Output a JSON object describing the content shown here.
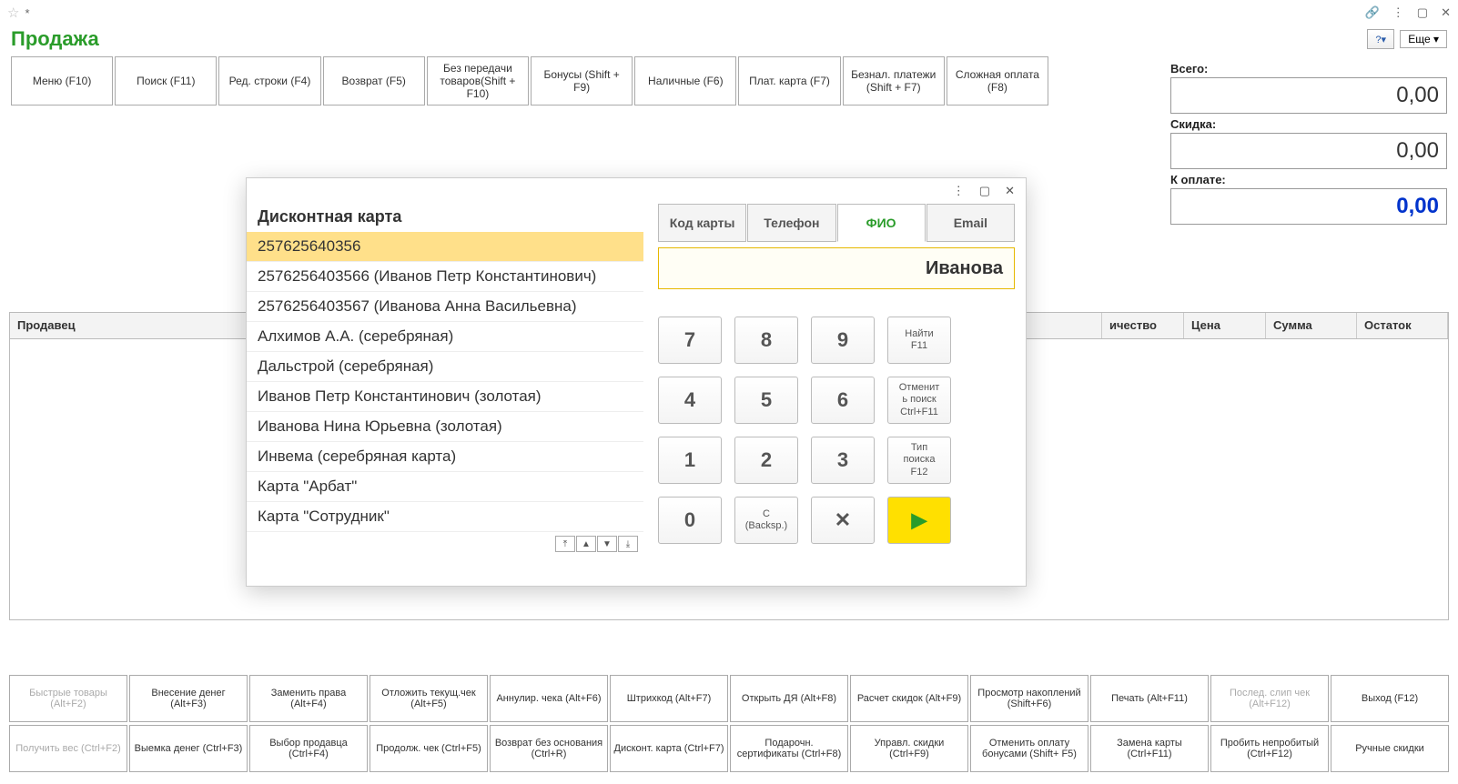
{
  "window": {
    "star": "☆",
    "asterisk": "*"
  },
  "title": "Продажа",
  "more_label": "Еще",
  "toolbar": [
    "Меню (F10)",
    "Поиск (F11)",
    "Ред. строки (F4)",
    "Возврат (F5)",
    "Без передачи товаров(Shift + F10)",
    "Бонусы (Shift + F9)",
    "Наличные (F6)",
    "Плат. карта (F7)",
    "Безнал. платежи (Shift + F7)",
    "Сложная оплата (F8)"
  ],
  "totals": {
    "vsego_label": "Всего:",
    "vsego_value": "0,00",
    "skidka_label": "Скидка:",
    "skidka_value": "0,00",
    "koplate_label": "К оплате:",
    "koplate_value": "0,00"
  },
  "grid_cols": [
    "Продавец",
    "ичество",
    "Цена",
    "Сумма",
    "Остаток"
  ],
  "bottom": [
    [
      {
        "t": "Быстрые товары (Alt+F2)",
        "d": true
      },
      {
        "t": "Внесение денег (Alt+F3)"
      },
      {
        "t": "Заменить права (Alt+F4)"
      },
      {
        "t": "Отложить текущ.чек (Alt+F5)"
      },
      {
        "t": "Аннулир. чека (Alt+F6)"
      },
      {
        "t": "Штрихкод (Alt+F7)"
      },
      {
        "t": "Открыть ДЯ (Alt+F8)"
      },
      {
        "t": "Расчет скидок (Alt+F9)"
      },
      {
        "t": "Просмотр накоплений (Shift+F6)"
      },
      {
        "t": "Печать (Alt+F11)"
      },
      {
        "t": "Послед. слип чек (Alt+F12)",
        "d": true
      },
      {
        "t": "Выход (F12)"
      }
    ],
    [
      {
        "t": "Получить вес (Ctrl+F2)",
        "d": true
      },
      {
        "t": "Выемка денег (Ctrl+F3)"
      },
      {
        "t": "Выбор продавца (Ctrl+F4)"
      },
      {
        "t": "Продолж. чек (Ctrl+F5)"
      },
      {
        "t": "Возврат без основания (Ctrl+R)"
      },
      {
        "t": "Дисконт. карта (Ctrl+F7)"
      },
      {
        "t": "Подарочн. сертификаты (Ctrl+F8)"
      },
      {
        "t": "Управл. скидки (Ctrl+F9)"
      },
      {
        "t": "Отменить оплату бонусами (Shift+ F5)"
      },
      {
        "t": "Замена карты (Ctrl+F11)"
      },
      {
        "t": "Пробить непробитый (Ctrl+F12)"
      },
      {
        "t": "Ручные скидки"
      }
    ]
  ],
  "dialog": {
    "list_title": "Дисконтная карта",
    "items": [
      "257625640356",
      "2576256403566 (Иванов  Петр  Константинович)",
      "2576256403567 (Иванова Анна Васильевна)",
      "Алхимов А.А. (серебряная)",
      "Дальстрой (серебряная)",
      "Иванов  Петр  Константинович (золотая)",
      "Иванова Нина Юрьевна (золотая)",
      "Инвема (серебряная карта)",
      "Карта \"Арбат\"",
      "Карта \"Сотрудник\""
    ],
    "tabs": [
      "Код карты",
      "Телефон",
      "ФИО",
      "Email"
    ],
    "search_value": "Иванова",
    "keys": {
      "find": "Найти\nF11",
      "cancel": "Отменит\nь поиск\nCtrl+F11",
      "type": "Тип\nпоиска\nF12",
      "backsp": "C\n(Backsp.)"
    }
  }
}
